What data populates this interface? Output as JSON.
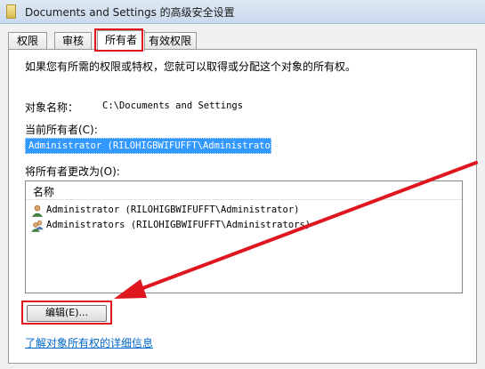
{
  "window": {
    "title": "Documents and Settings 的高级安全设置"
  },
  "tabs": [
    {
      "label": "权限"
    },
    {
      "label": "审核"
    },
    {
      "label": "所有者"
    },
    {
      "label": "有效权限"
    }
  ],
  "owner_tab": {
    "description": "如果您有所需的权限或特权，您就可以取得或分配这个对象的所有权。",
    "object_name_label": "对象名称：",
    "object_name_value": "C:\\Documents and Settings",
    "current_owner_label": "当前所有者(C):",
    "current_owner_value": "Administrator (RILOHIGBWIFUFFT\\Administrator)",
    "change_owner_label": "将所有者更改为(O):",
    "list": {
      "column_header": "名称",
      "items": [
        {
          "label": "Administrator (RILOHIGBWIFUFFT\\Administrator)",
          "icon": "user-icon"
        },
        {
          "label": "Administrators (RILOHIGBWIFUFFT\\Administrators)",
          "icon": "users-group-icon"
        }
      ]
    },
    "edit_button": "编辑(E)...",
    "learn_more_link": "了解对象所有权的详细信息"
  },
  "annotation_color": "#e0161e"
}
